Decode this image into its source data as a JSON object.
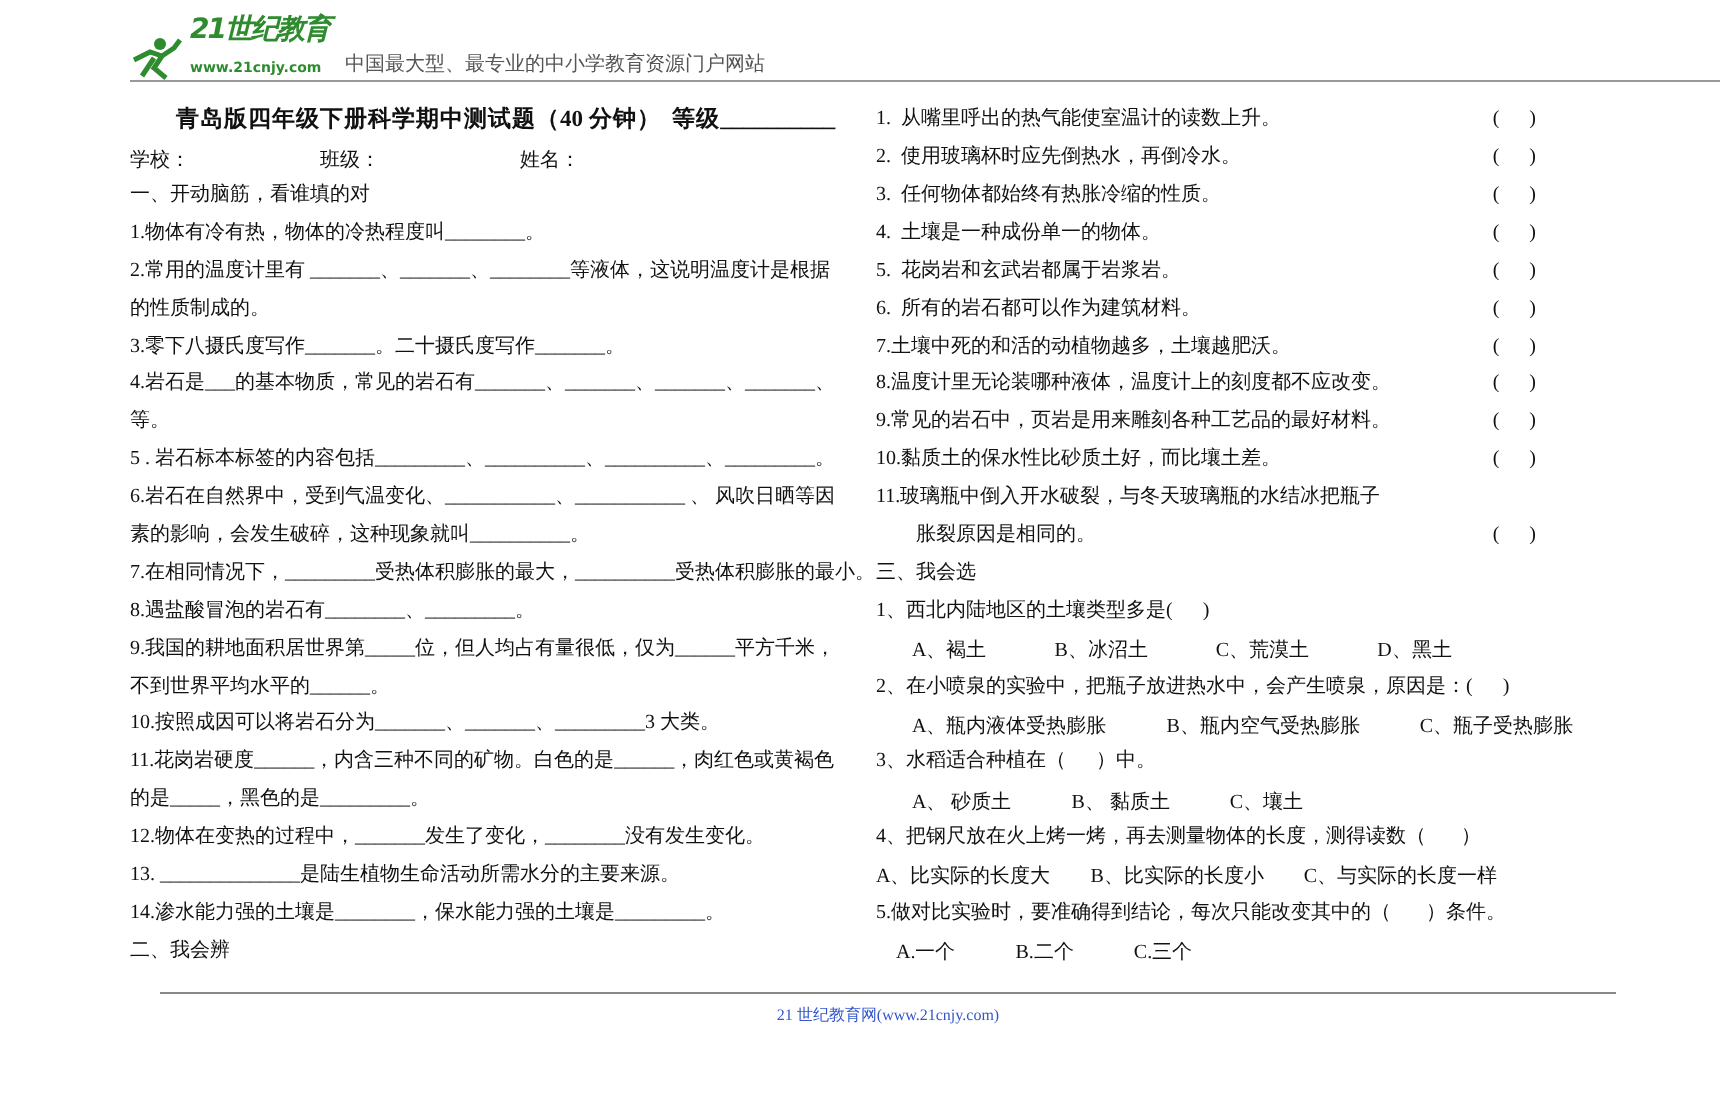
{
  "header": {
    "logo_text": "21世纪教育",
    "logo_url": "www.21cnjy.com",
    "tagline": "中国最大型、最专业的中小学教育资源门户网站"
  },
  "title": {
    "text": "青岛版四年级下册科学期中测试题（40 分钟）",
    "grade": "等级__________"
  },
  "info": [
    "学校：",
    "班级：",
    "姓名："
  ],
  "section_1": {
    "heading": "一、开动脑筋，看谁填的对",
    "lines": [
      {
        "text": "1.物体有冷有热，物体的冷热程度叫________。"
      },
      {
        "text": "2.常用的温度计里有 _______、_______、________等液体，这说明温度计是根据"
      },
      {
        "text": "的性质制成的。"
      },
      {
        "text": "3.零下八摄氏度写作_______。二十摄氏度写作_______。"
      },
      {
        "text": "4.岩石是___的基本物质，常见的岩石有_______、_______、_______、_______、"
      },
      {
        "text": "等。"
      },
      {
        "text": "5 . 岩石标本标签的内容包括_________、__________、__________、_________。"
      },
      {
        "text": "6.岩石在自然界中，受到气温变化、___________、___________ 、 风吹日晒等因"
      },
      {
        "text": "素的影响，会发生破碎，这种现象就叫__________。"
      },
      {
        "text": "7.在相同情况下，_________受热体积膨胀的最大，__________受热体积膨胀的最小。"
      },
      {
        "text": "8.遇盐酸冒泡的岩石有________、_________。"
      },
      {
        "text": "9.我国的耕地面积居世界第_____位，但人均占有量很低，仅为______平方千米，"
      },
      {
        "text": "不到世界平均水平的______。"
      },
      {
        "text": "10.按照成因可以将岩石分为_______、_______、_________3 大类。"
      },
      {
        "text": "11.花岗岩硬度______，内含三种不同的矿物。白色的是______，肉红色或黄褐色"
      },
      {
        "text": "的是_____，黑色的是_________。"
      },
      {
        "text": "12.物体在变热的过程中，_______发生了变化，________没有发生变化。"
      },
      {
        "text": "13. ______________是陆生植物生命活动所需水分的主要来源。"
      },
      {
        "text": "14.渗水能力强的土壤是________，保水能力强的土壤是_________。"
      }
    ]
  },
  "section_2": {
    "heading": "二、我会辨",
    "items": [
      {
        "lines": [
          "1.  从嘴里呼出的热气能使室温计的读数上升。"
        ],
        "answer": "(      )"
      },
      {
        "lines": [
          "2.  使用玻璃杯时应先倒热水，再倒冷水。"
        ],
        "answer": "(      )"
      },
      {
        "lines": [
          "3.  任何物体都始终有热胀冷缩的性质。"
        ],
        "answer": "(      )"
      },
      {
        "lines": [
          "4.  土壤是一种成份单一的物体。"
        ],
        "answer": "(      )"
      },
      {
        "lines": [
          "5.  花岗岩和玄武岩都属于岩浆岩。"
        ],
        "answer": "(      )"
      },
      {
        "lines": [
          "6.  所有的岩石都可以作为建筑材料。"
        ],
        "answer": "(      )"
      },
      {
        "lines": [
          "7.土壤中死的和活的动植物越多，土壤越肥沃。"
        ],
        "answer": "(      )"
      },
      {
        "lines": [
          "8.温度计里无论装哪种液体，温度计上的刻度都不应改变。"
        ],
        "answer": "(      )"
      },
      {
        "lines": [
          "9.常见的岩石中，页岩是用来雕刻各种工艺品的最好材料。"
        ],
        "answer": "(      )"
      },
      {
        "lines": [
          "10.黏质土的保水性比砂质土好，而比壤土差。"
        ],
        "answer": "(      )"
      },
      {
        "lines": [
          "11.玻璃瓶中倒入开水破裂，与冬天玻璃瓶的水结冰把瓶子",
          "胀裂原因是相同的。"
        ],
        "answer": "(      )"
      }
    ]
  },
  "section_3": {
    "heading": "三、我会选",
    "questions": [
      {
        "text": "1、西北内陆地区的土壤类型多是(      )",
        "options": [
          "A、褐土",
          "B、冰沼土",
          "C、荒漠土",
          "D、黑土"
        ]
      },
      {
        "text": "2、在小喷泉的实验中，把瓶子放进热水中，会产生喷泉，原因是：(      )",
        "options": [
          "A、瓶内液体受热膨胀",
          "B、瓶内空气受热膨胀",
          "C、瓶子受热膨胀"
        ]
      },
      {
        "text": "3、水稻适合种植在（      ）中。",
        "options": [
          "A、 砂质土",
          "B、 黏质土",
          "C、壤土"
        ]
      },
      {
        "text": "4、把钢尺放在火上烤一烤，再去测量物体的长度，测得读数（       ）",
        "options": [
          "A、比实际的长度大",
          "B、比实际的长度小",
          "C、与实际的长度一样"
        ]
      },
      {
        "text": "5.做对比实验时，要准确得到结论，每次只能改变其中的（       ）条件。",
        "options": [
          "A.一个",
          "B.二个",
          "C.三个"
        ]
      }
    ]
  },
  "footer": "21 世纪教育网(www.21cnjy.com)"
}
